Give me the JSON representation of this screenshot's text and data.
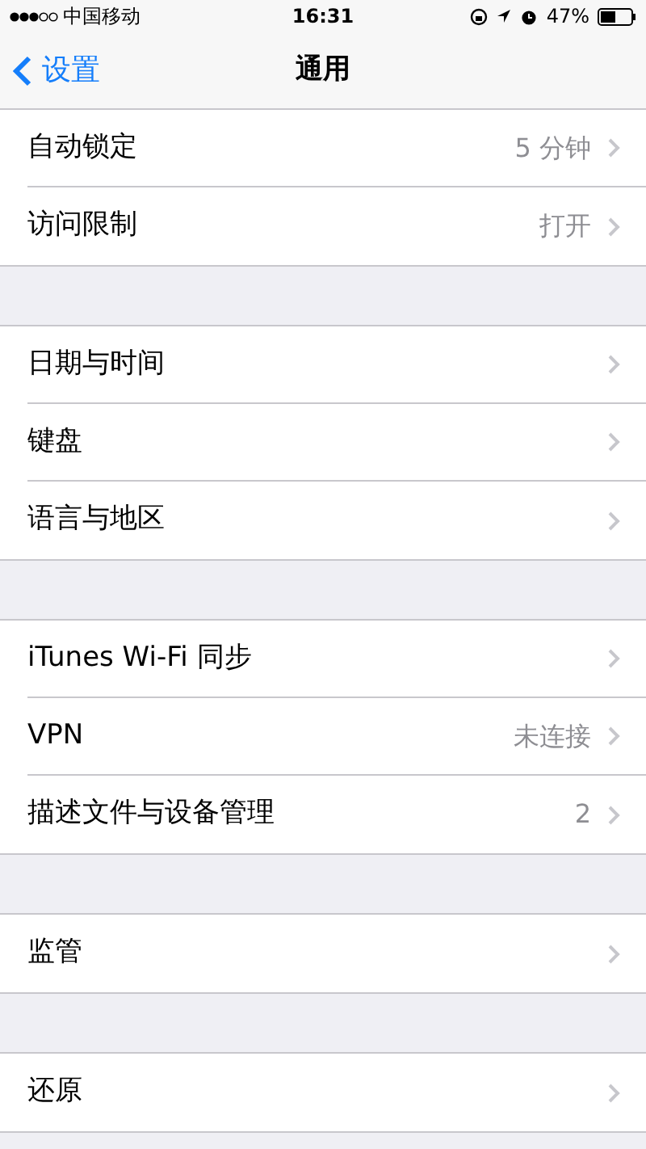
{
  "status_bar": {
    "carrier": "中国移动",
    "time": "16:31",
    "battery": "47%"
  },
  "nav": {
    "back": "设置",
    "title": "通用"
  },
  "groups": [
    {
      "rows": [
        {
          "label": "自动锁定",
          "value": "5 分钟"
        },
        {
          "label": "访问限制",
          "value": "打开"
        }
      ]
    },
    {
      "rows": [
        {
          "label": "日期与时间"
        },
        {
          "label": "键盘"
        },
        {
          "label": "语言与地区"
        }
      ]
    },
    {
      "rows": [
        {
          "label": "iTunes Wi-Fi 同步"
        },
        {
          "label": "VPN",
          "value": "未连接"
        },
        {
          "label": "描述文件与设备管理",
          "value": "2"
        }
      ]
    },
    {
      "rows": [
        {
          "label": "监管"
        }
      ]
    },
    {
      "rows": [
        {
          "label": "还原"
        }
      ]
    }
  ]
}
